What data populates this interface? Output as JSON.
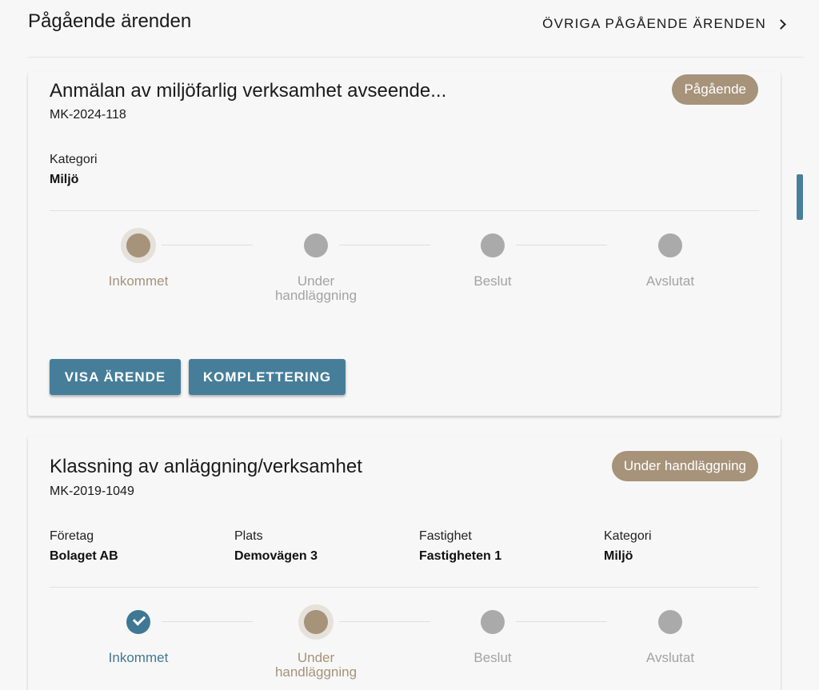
{
  "header": {
    "title": "Pågående ärenden",
    "other_link": "ÖVRIGA PÅGÅENDE ÄRENDEN"
  },
  "cases": [
    {
      "title": "Anmälan av miljöfarlig verksamhet avseende...",
      "case_number": "MK-2024-118",
      "status": "Pågående",
      "meta": [
        {
          "label": "Kategori",
          "value": "Miljö"
        }
      ],
      "steps": [
        {
          "label": "Inkommet",
          "state": "active"
        },
        {
          "label": "Under handläggning",
          "state": "pending"
        },
        {
          "label": "Beslut",
          "state": "pending"
        },
        {
          "label": "Avslutat",
          "state": "pending"
        }
      ],
      "buttons": {
        "view": "VISA ÄRENDE",
        "complement": "KOMPLETTERING"
      }
    },
    {
      "title": "Klassning av anläggning/verksamhet",
      "case_number": "MK-2019-1049",
      "status": "Under handläggning",
      "meta": [
        {
          "label": "Företag",
          "value": "Bolaget AB"
        },
        {
          "label": "Plats",
          "value": "Demovägen 3"
        },
        {
          "label": "Fastighet",
          "value": "Fastigheten 1"
        },
        {
          "label": "Kategori",
          "value": "Miljö"
        }
      ],
      "steps": [
        {
          "label": "Inkommet",
          "state": "done"
        },
        {
          "label": "Under handläggning",
          "state": "active"
        },
        {
          "label": "Beslut",
          "state": "pending"
        },
        {
          "label": "Avslutat",
          "state": "pending"
        }
      ]
    }
  ],
  "colors": {
    "accent_blue": "#467e9a",
    "status_tan": "#a69379",
    "pending_grey": "#aaaaaa"
  }
}
